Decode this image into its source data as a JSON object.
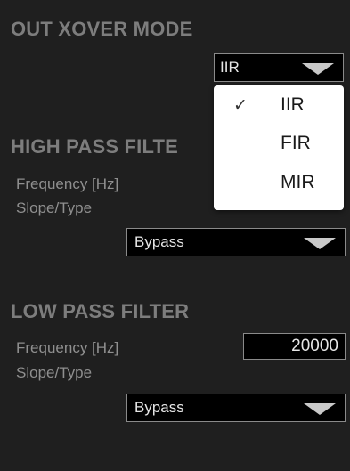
{
  "out_xover": {
    "title": "OUT XOVER MODE",
    "mode_value": "IIR",
    "menu": {
      "options": [
        "IIR",
        "FIR",
        "MIR"
      ],
      "selected": "IIR",
      "check_glyph": "✓"
    }
  },
  "high_pass": {
    "title": "HIGH PASS FILTE",
    "frequency_label": "Frequency [Hz]",
    "slope_label": "Slope/Type",
    "slope_value": "Bypass"
  },
  "low_pass": {
    "title": "LOW PASS FILTER",
    "frequency_label": "Frequency [Hz]",
    "frequency_value": "20000",
    "slope_label": "Slope/Type",
    "slope_value": "Bypass"
  },
  "icons": {
    "dropdown_arrow": "chevron-down-icon",
    "check": "checkmark-icon"
  },
  "colors": {
    "background": "#1f1f1f",
    "section_title": "#7d7d7d",
    "label": "#8f8f8f",
    "field_bg": "#000000",
    "menu_bg": "#ffffff"
  }
}
